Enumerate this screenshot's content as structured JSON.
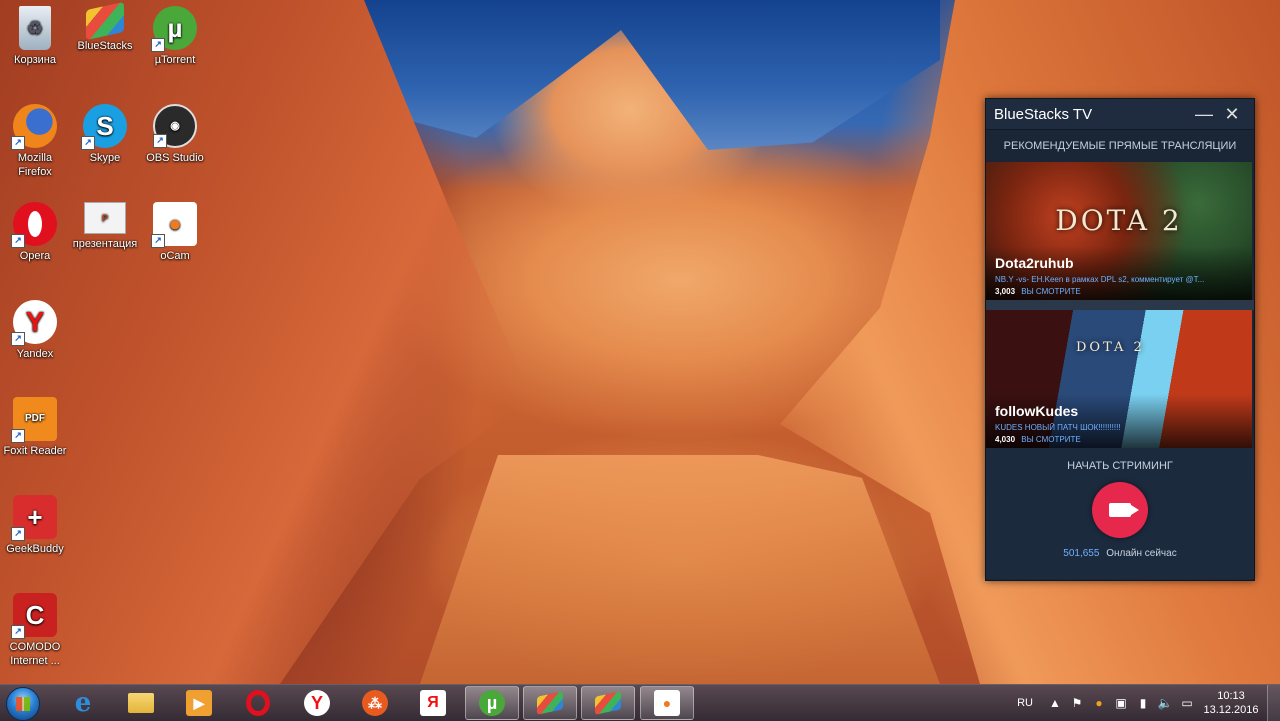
{
  "desktop": {
    "icons": [
      {
        "label": "Корзина",
        "icon": "recycle-bin-icon"
      },
      {
        "label": "BlueStacks",
        "icon": "bluestacks-icon"
      },
      {
        "label": "µTorrent",
        "icon": "utorrent-icon"
      },
      {
        "label": "Mozilla Firefox",
        "icon": "firefox-icon"
      },
      {
        "label": "Skype",
        "icon": "skype-icon"
      },
      {
        "label": "OBS Studio",
        "icon": "obs-icon"
      },
      {
        "label": "Opera",
        "icon": "opera-icon"
      },
      {
        "label": "презентация",
        "icon": "powerpoint-file-icon"
      },
      {
        "label": "oCam",
        "icon": "ocam-icon"
      },
      {
        "label": "Yandex",
        "icon": "yandex-icon"
      },
      {
        "label": "Foxit Reader",
        "icon": "foxit-reader-icon"
      },
      {
        "label": "GeekBuddy",
        "icon": "geekbuddy-icon"
      },
      {
        "label": "COMODO Internet ...",
        "icon": "comodo-icon"
      }
    ]
  },
  "bstv": {
    "title": "BlueStacks TV",
    "minimize": "—",
    "close": "✕",
    "section_title": "РЕКОМЕНДУЕМЫЕ ПРЯМЫЕ ТРАНСЛЯЦИИ",
    "streams": [
      {
        "logo": "DOTA 2",
        "name": "Dota2ruhub",
        "desc": "NB.Y -vs- EH.Keen в рамках DPL s2, комментирует @T...",
        "viewers": "3,003",
        "watching": "ВЫ СМОТРИТЕ"
      },
      {
        "logo": "DOTA 2",
        "name": "followKudes",
        "desc": "KUDES НОВЫЙ ПАТЧ ШОК!!!!!!!!!!",
        "viewers": "4,030",
        "watching": "ВЫ СМОТРИТЕ"
      }
    ],
    "start_streaming": "НАЧАТЬ СТРИМИНГ",
    "online_count": "501,655",
    "online_label": "Онлайн сейчас"
  },
  "taskbar": {
    "apps": [
      {
        "name": "internet-explorer",
        "glyph": "e",
        "open": false
      },
      {
        "name": "file-explorer",
        "glyph": "",
        "open": false
      },
      {
        "name": "media-player",
        "glyph": "▶",
        "open": false
      },
      {
        "name": "opera",
        "glyph": "",
        "open": false
      },
      {
        "name": "yandex-browser",
        "glyph": "Y",
        "open": false
      },
      {
        "name": "dots-app",
        "glyph": "⁂",
        "open": false
      },
      {
        "name": "yandex",
        "glyph": "Я",
        "open": false
      },
      {
        "name": "utorrent",
        "glyph": "µ",
        "open": true
      },
      {
        "name": "bluestacks",
        "glyph": "",
        "open": true
      },
      {
        "name": "bluestacks-2",
        "glyph": "",
        "open": true
      },
      {
        "name": "ocam",
        "glyph": "●",
        "open": true
      }
    ],
    "language": "RU",
    "time": "10:13",
    "date": "13.12.2016"
  }
}
